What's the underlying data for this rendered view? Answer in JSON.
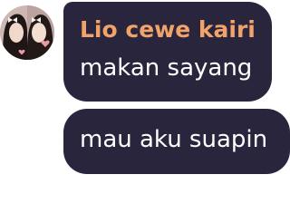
{
  "chat": {
    "sender_name": "Lio cewe kairi",
    "sender_name_color": "#f1a36a",
    "bubble_color": "#29253d",
    "messages": [
      {
        "text": "makan sayang"
      },
      {
        "text": "mau aku suapin"
      }
    ],
    "avatar_icon": "profile-photo"
  }
}
